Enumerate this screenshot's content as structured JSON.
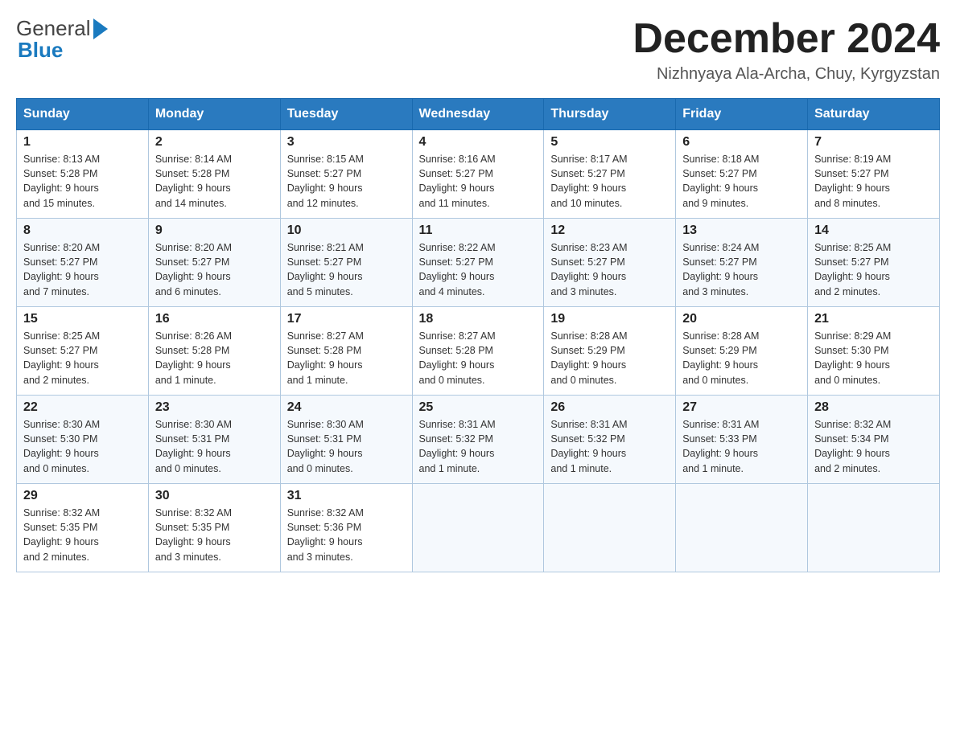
{
  "header": {
    "logo_general": "General",
    "logo_blue": "Blue",
    "title": "December 2024",
    "location": "Nizhnyaya Ala-Archa, Chuy, Kyrgyzstan"
  },
  "days_of_week": [
    "Sunday",
    "Monday",
    "Tuesday",
    "Wednesday",
    "Thursday",
    "Friday",
    "Saturday"
  ],
  "weeks": [
    [
      {
        "day": "1",
        "sunrise": "8:13 AM",
        "sunset": "5:28 PM",
        "daylight": "9 hours and 15 minutes."
      },
      {
        "day": "2",
        "sunrise": "8:14 AM",
        "sunset": "5:28 PM",
        "daylight": "9 hours and 14 minutes."
      },
      {
        "day": "3",
        "sunrise": "8:15 AM",
        "sunset": "5:27 PM",
        "daylight": "9 hours and 12 minutes."
      },
      {
        "day": "4",
        "sunrise": "8:16 AM",
        "sunset": "5:27 PM",
        "daylight": "9 hours and 11 minutes."
      },
      {
        "day": "5",
        "sunrise": "8:17 AM",
        "sunset": "5:27 PM",
        "daylight": "9 hours and 10 minutes."
      },
      {
        "day": "6",
        "sunrise": "8:18 AM",
        "sunset": "5:27 PM",
        "daylight": "9 hours and 9 minutes."
      },
      {
        "day": "7",
        "sunrise": "8:19 AM",
        "sunset": "5:27 PM",
        "daylight": "9 hours and 8 minutes."
      }
    ],
    [
      {
        "day": "8",
        "sunrise": "8:20 AM",
        "sunset": "5:27 PM",
        "daylight": "9 hours and 7 minutes."
      },
      {
        "day": "9",
        "sunrise": "8:20 AM",
        "sunset": "5:27 PM",
        "daylight": "9 hours and 6 minutes."
      },
      {
        "day": "10",
        "sunrise": "8:21 AM",
        "sunset": "5:27 PM",
        "daylight": "9 hours and 5 minutes."
      },
      {
        "day": "11",
        "sunrise": "8:22 AM",
        "sunset": "5:27 PM",
        "daylight": "9 hours and 4 minutes."
      },
      {
        "day": "12",
        "sunrise": "8:23 AM",
        "sunset": "5:27 PM",
        "daylight": "9 hours and 3 minutes."
      },
      {
        "day": "13",
        "sunrise": "8:24 AM",
        "sunset": "5:27 PM",
        "daylight": "9 hours and 3 minutes."
      },
      {
        "day": "14",
        "sunrise": "8:25 AM",
        "sunset": "5:27 PM",
        "daylight": "9 hours and 2 minutes."
      }
    ],
    [
      {
        "day": "15",
        "sunrise": "8:25 AM",
        "sunset": "5:27 PM",
        "daylight": "9 hours and 2 minutes."
      },
      {
        "day": "16",
        "sunrise": "8:26 AM",
        "sunset": "5:28 PM",
        "daylight": "9 hours and 1 minute."
      },
      {
        "day": "17",
        "sunrise": "8:27 AM",
        "sunset": "5:28 PM",
        "daylight": "9 hours and 1 minute."
      },
      {
        "day": "18",
        "sunrise": "8:27 AM",
        "sunset": "5:28 PM",
        "daylight": "9 hours and 0 minutes."
      },
      {
        "day": "19",
        "sunrise": "8:28 AM",
        "sunset": "5:29 PM",
        "daylight": "9 hours and 0 minutes."
      },
      {
        "day": "20",
        "sunrise": "8:28 AM",
        "sunset": "5:29 PM",
        "daylight": "9 hours and 0 minutes."
      },
      {
        "day": "21",
        "sunrise": "8:29 AM",
        "sunset": "5:30 PM",
        "daylight": "9 hours and 0 minutes."
      }
    ],
    [
      {
        "day": "22",
        "sunrise": "8:30 AM",
        "sunset": "5:30 PM",
        "daylight": "9 hours and 0 minutes."
      },
      {
        "day": "23",
        "sunrise": "8:30 AM",
        "sunset": "5:31 PM",
        "daylight": "9 hours and 0 minutes."
      },
      {
        "day": "24",
        "sunrise": "8:30 AM",
        "sunset": "5:31 PM",
        "daylight": "9 hours and 0 minutes."
      },
      {
        "day": "25",
        "sunrise": "8:31 AM",
        "sunset": "5:32 PM",
        "daylight": "9 hours and 1 minute."
      },
      {
        "day": "26",
        "sunrise": "8:31 AM",
        "sunset": "5:32 PM",
        "daylight": "9 hours and 1 minute."
      },
      {
        "day": "27",
        "sunrise": "8:31 AM",
        "sunset": "5:33 PM",
        "daylight": "9 hours and 1 minute."
      },
      {
        "day": "28",
        "sunrise": "8:32 AM",
        "sunset": "5:34 PM",
        "daylight": "9 hours and 2 minutes."
      }
    ],
    [
      {
        "day": "29",
        "sunrise": "8:32 AM",
        "sunset": "5:35 PM",
        "daylight": "9 hours and 2 minutes."
      },
      {
        "day": "30",
        "sunrise": "8:32 AM",
        "sunset": "5:35 PM",
        "daylight": "9 hours and 3 minutes."
      },
      {
        "day": "31",
        "sunrise": "8:32 AM",
        "sunset": "5:36 PM",
        "daylight": "9 hours and 3 minutes."
      },
      null,
      null,
      null,
      null
    ]
  ]
}
